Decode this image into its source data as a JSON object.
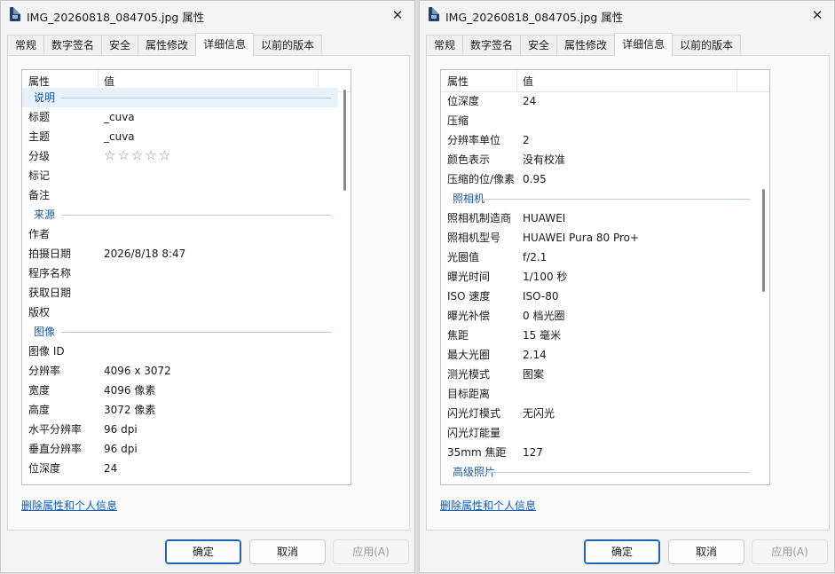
{
  "left": {
    "title": "IMG_20260818_084705.jpg 属性",
    "tabs": [
      "常规",
      "数字签名",
      "安全",
      "属性修改",
      "详细信息",
      "以前的版本"
    ],
    "header": {
      "prop": "属性",
      "value": "值"
    },
    "rows": [
      {
        "type": "section",
        "label": "说明"
      },
      {
        "label": "标题",
        "value": "_cuva"
      },
      {
        "label": "主题",
        "value": "_cuva"
      },
      {
        "label": "分级",
        "value": "☆☆☆☆☆"
      },
      {
        "label": "标记",
        "value": ""
      },
      {
        "label": "备注",
        "value": ""
      },
      {
        "type": "section",
        "label": "来源"
      },
      {
        "label": "作者",
        "value": ""
      },
      {
        "label": "拍摄日期",
        "value": "2026/8/18 8:47"
      },
      {
        "label": "程序名称",
        "value": ""
      },
      {
        "label": "获取日期",
        "value": ""
      },
      {
        "label": "版权",
        "value": ""
      },
      {
        "type": "section",
        "label": "图像"
      },
      {
        "label": "图像 ID",
        "value": ""
      },
      {
        "label": "分辨率",
        "value": "4096 x 3072"
      },
      {
        "label": "宽度",
        "value": "4096 像素"
      },
      {
        "label": "高度",
        "value": "3072 像素"
      },
      {
        "label": "水平分辨率",
        "value": "96 dpi"
      },
      {
        "label": "垂直分辨率",
        "value": "96 dpi"
      },
      {
        "label": "位深度",
        "value": "24"
      }
    ],
    "link": "删除属性和个人信息",
    "buttons": {
      "ok": "确定",
      "cancel": "取消",
      "apply": "应用(A)"
    }
  },
  "right": {
    "title": "IMG_20260818_084705.jpg 属性",
    "tabs": [
      "常规",
      "数字签名",
      "安全",
      "属性修改",
      "详细信息",
      "以前的版本"
    ],
    "header": {
      "prop": "属性",
      "value": "值"
    },
    "rows": [
      {
        "label": "位深度",
        "value": "24"
      },
      {
        "label": "压缩",
        "value": ""
      },
      {
        "label": "分辨率单位",
        "value": "2"
      },
      {
        "label": "颜色表示",
        "value": "没有校准"
      },
      {
        "label": "压缩的位/像素",
        "value": "0.95"
      },
      {
        "type": "section",
        "label": "照相机"
      },
      {
        "label": "照相机制造商",
        "value": "HUAWEI"
      },
      {
        "label": "照相机型号",
        "value": "HUAWEI Pura 80 Pro+"
      },
      {
        "label": "光圈值",
        "value": "f/2.1"
      },
      {
        "label": "曝光时间",
        "value": "1/100 秒"
      },
      {
        "label": "ISO 速度",
        "value": "ISO-80"
      },
      {
        "label": "曝光补偿",
        "value": "0 档光圈"
      },
      {
        "label": "焦距",
        "value": "15 毫米"
      },
      {
        "label": "最大光圈",
        "value": "2.14"
      },
      {
        "label": "测光模式",
        "value": "图案"
      },
      {
        "label": "目标距离",
        "value": ""
      },
      {
        "label": "闪光灯模式",
        "value": "无闪光"
      },
      {
        "label": "闪光灯能量",
        "value": ""
      },
      {
        "label": "35mm 焦距",
        "value": "127"
      },
      {
        "type": "section",
        "label": "高级照片"
      }
    ],
    "link": "删除属性和个人信息",
    "buttons": {
      "ok": "确定",
      "cancel": "取消",
      "apply": "应用(A)"
    }
  }
}
